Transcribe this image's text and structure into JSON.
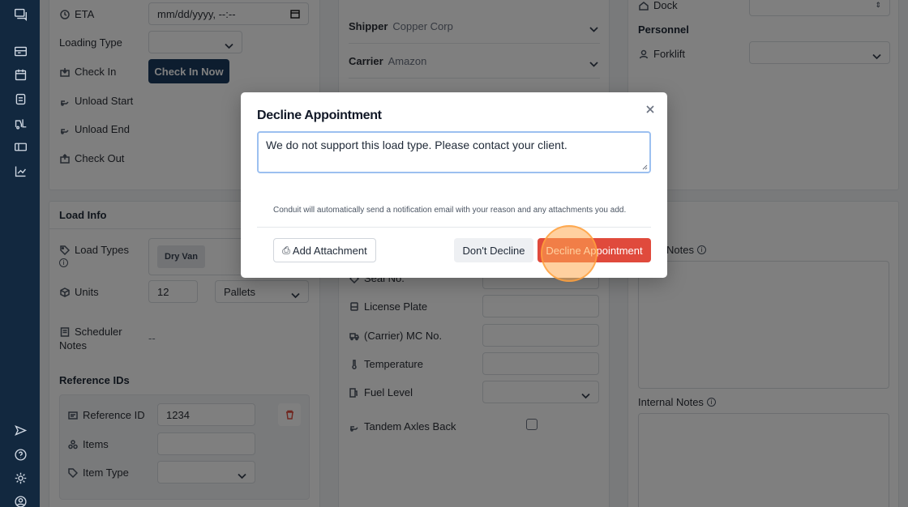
{
  "sidebar": {
    "icons": [
      "chat-icon",
      "inbox-icon",
      "calendar-icon",
      "document-icon",
      "forklift-icon",
      "ticket-icon",
      "chart-icon",
      "send-icon",
      "help-icon",
      "settings-icon",
      "user-icon"
    ]
  },
  "left_panel": {
    "eta_label": "ETA",
    "eta_value": "mm/dd/yyyy, --:--",
    "loading_type_label": "Loading Type",
    "check_in_label": "Check In",
    "check_in_button": "Check In Now",
    "unload_start_label": "Unload Start",
    "unload_end_label": "Unload End",
    "check_out_label": "Check Out"
  },
  "middle_panel": {
    "shipper_label": "Shipper",
    "shipper_value": "Copper Corp",
    "carrier_label": "Carrier",
    "carrier_value": "Amazon"
  },
  "right_panel": {
    "dock_label": "Dock",
    "personnel_title": "Personnel",
    "forklift_label": "Forklift"
  },
  "load_info": {
    "title": "Load Info",
    "load_types_label": "Load Types",
    "load_type_chip": "Dry Van",
    "units_label": "Units",
    "units_value": "12",
    "units_type": "Pallets",
    "scheduler_notes_label_1": "Scheduler",
    "scheduler_notes_label_2": "Notes",
    "scheduler_notes_value": "--",
    "reference_ids_title": "Reference IDs",
    "reference_id_label": "Reference ID",
    "reference_id_value": "1234",
    "items_label": "Items",
    "item_type_label": "Item Type"
  },
  "middle_lower": {
    "seal_label": "Seal No.",
    "license_label": "License Plate",
    "mc_label": "(Carrier) MC No.",
    "temperature_label": "Temperature",
    "fuel_label": "Fuel Level",
    "tandem_label": "Tandem Axles Back"
  },
  "right_lower": {
    "notes_label": "Notes",
    "internal_notes_label": "Internal Notes"
  },
  "modal": {
    "title": "Decline Appointment",
    "reason_text": "We do not support this load type. Please contact your client.",
    "notice": "Conduit will automatically send a notification email with your reason and any attachments you add.",
    "attach_label": "Add Attachment",
    "dont_decline_label": "Don't Decline",
    "decline_label": "Decline Appointment"
  },
  "colors": {
    "sidebar": "#12283f",
    "primary": "#1b3b5f",
    "danger": "#e04a3c"
  }
}
